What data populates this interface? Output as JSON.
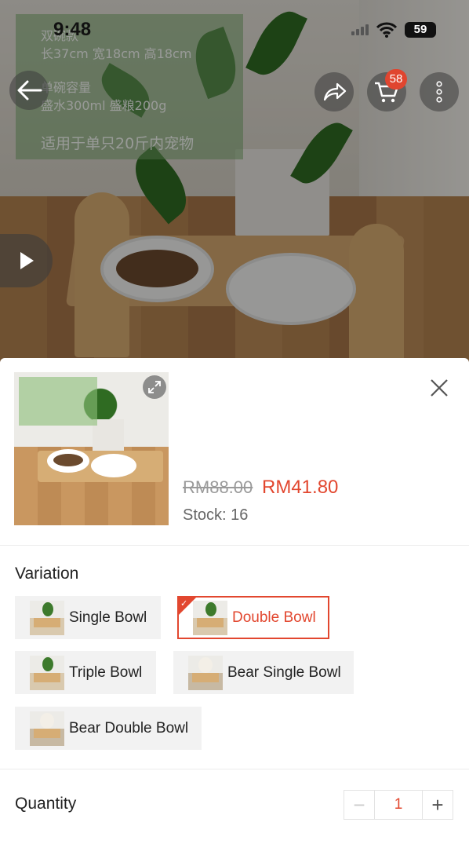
{
  "status_bar": {
    "time": "9:48",
    "battery": "59"
  },
  "hero": {
    "label_lines": [
      "双碗款",
      "长37cm  宽18cm  高18cm",
      "单碗容量",
      "盛水300ml  盛粮200g",
      "适用于单只20斤内宠物"
    ]
  },
  "top_nav": {
    "cart_count": "58"
  },
  "product": {
    "price_original": "RM88.00",
    "price_sale": "RM41.80",
    "stock_label": "Stock: 16",
    "accent_color": "#e2472f"
  },
  "variation": {
    "title": "Variation",
    "options": [
      {
        "label": "Single Bowl",
        "selected": false
      },
      {
        "label": "Double Bowl",
        "selected": true
      },
      {
        "label": "Triple Bowl",
        "selected": false
      },
      {
        "label": "Bear Single Bowl",
        "selected": false
      },
      {
        "label": "Bear Double Bowl",
        "selected": false
      }
    ]
  },
  "quantity": {
    "title": "Quantity",
    "value": "1",
    "minus": "−",
    "plus": "+"
  }
}
